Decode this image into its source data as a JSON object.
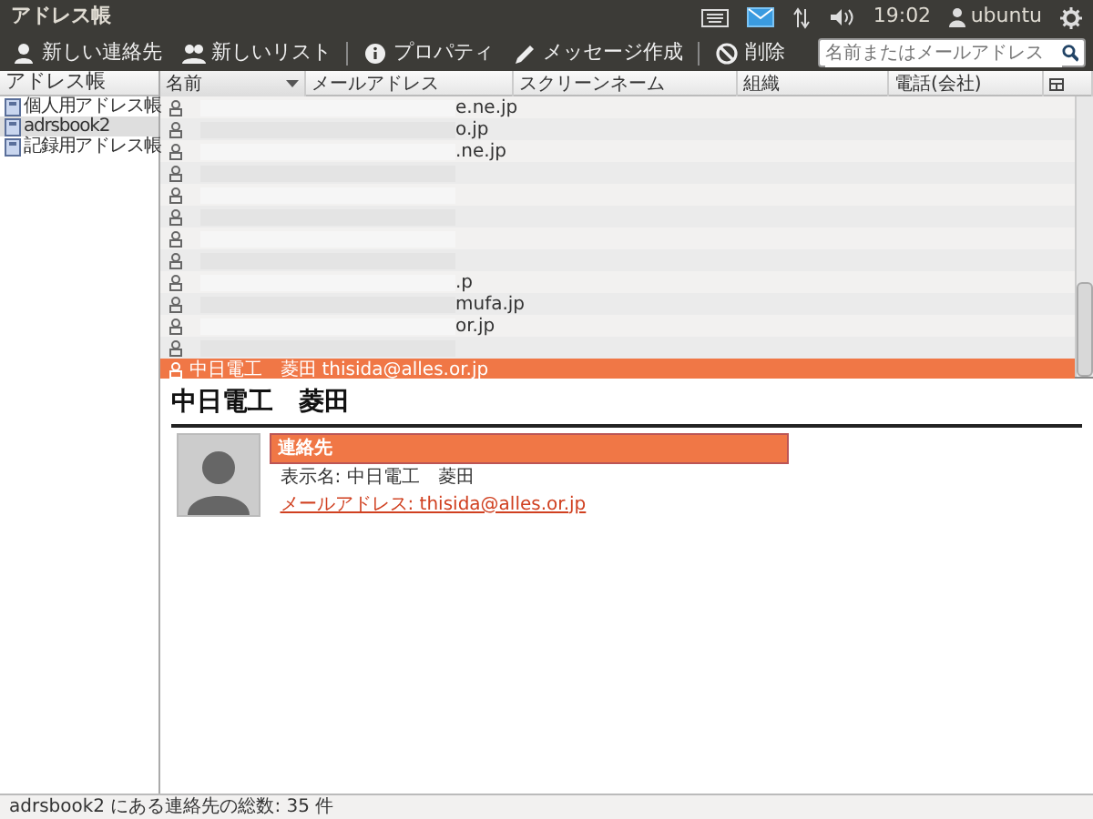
{
  "window": {
    "title": "アドレス帳"
  },
  "top_panel": {
    "time": "19:02",
    "user": "ubuntu"
  },
  "toolbar": {
    "items": [
      {
        "kind": "button",
        "label": "新しい連絡先"
      },
      {
        "kind": "button",
        "label": "新しいリスト"
      },
      {
        "kind": "separator"
      },
      {
        "kind": "button",
        "label": "プロパティ"
      },
      {
        "kind": "button",
        "label": "メッセージ作成"
      },
      {
        "kind": "separator"
      },
      {
        "kind": "button",
        "label": "削除"
      }
    ],
    "search": {
      "placeholder": "名前またはメールアドレス"
    }
  },
  "sidebar": {
    "header": "アドレス帳",
    "items": [
      {
        "label": "個人用アドレス帳",
        "selected": false
      },
      {
        "label": "adrsbook2",
        "selected": true
      },
      {
        "label": "記録用アドレス帳",
        "selected": false
      }
    ]
  },
  "table": {
    "columns": [
      {
        "label": "名前",
        "sorted": true
      },
      {
        "label": "メールアドレス",
        "sorted": false
      },
      {
        "label": "スクリーンネーム",
        "sorted": false
      },
      {
        "label": "組織",
        "sorted": false
      },
      {
        "label": "電話(会社)",
        "sorted": false
      }
    ],
    "rows": [
      {
        "email": "e.ne.jp",
        "selected": false
      },
      {
        "email": "o.jp",
        "selected": false
      },
      {
        "email": ".ne.jp",
        "selected": false
      },
      {
        "selected": false
      },
      {
        "selected": false
      },
      {
        "selected": false
      },
      {
        "selected": false
      },
      {
        "selected": false
      },
      {
        "email": ".p",
        "selected": false
      },
      {
        "email": "mufa.jp",
        "selected": false
      },
      {
        "email": "or.jp",
        "selected": false
      },
      {
        "selected": false
      },
      {
        "name": "中日電工　菱田",
        "email": "thisida@alles.or.jp",
        "selected": true
      }
    ]
  },
  "detail": {
    "title": "中日電工　菱田",
    "section": "連絡先",
    "display_name": "表示名: 中日電工　菱田",
    "email_link": "メールアドレス: thisida@alles.or.jp"
  },
  "status_bar": "adrsbook2 にある連絡先の総数: 35 件"
}
